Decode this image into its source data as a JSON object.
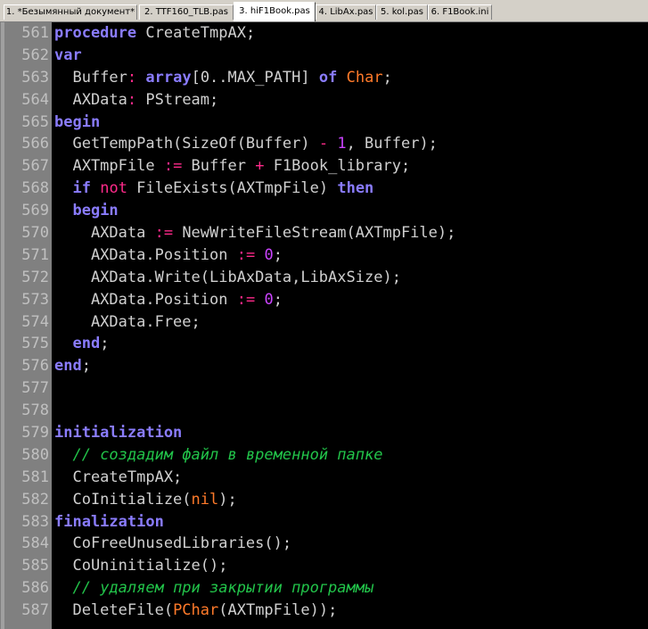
{
  "tabs": [
    {
      "label": "1. *Безымянный документ*",
      "active": false
    },
    {
      "label": "2. TTF160_TLB.pas",
      "active": false
    },
    {
      "label": "3. hiF1Book.pas",
      "active": true
    },
    {
      "label": "4. LibAx.pas",
      "active": false
    },
    {
      "label": "5. kol.pas",
      "active": false
    },
    {
      "label": "6. F1Book.ini",
      "active": false
    }
  ],
  "colors": {
    "background": "#000000",
    "gutter": "#808080",
    "keyword": "#8a7cff",
    "operator": "#ff2a8a",
    "number": "#cc44ff",
    "type": "#ff7a2a",
    "comment": "#22c44a",
    "identifier": "#d0d0d0"
  },
  "lines": [
    {
      "num": "561",
      "tokens": [
        {
          "t": "procedure",
          "c": "kw"
        },
        {
          "t": " CreateTmpAX;",
          "c": "id"
        }
      ]
    },
    {
      "num": "562",
      "tokens": [
        {
          "t": "var",
          "c": "kw"
        }
      ]
    },
    {
      "num": "563",
      "tokens": [
        {
          "t": "  Buffer",
          "c": "id"
        },
        {
          "t": ":",
          "c": "sym"
        },
        {
          "t": " ",
          "c": "id"
        },
        {
          "t": "array",
          "c": "kw"
        },
        {
          "t": "[0..MAX_PATH] ",
          "c": "id"
        },
        {
          "t": "of",
          "c": "kw"
        },
        {
          "t": " ",
          "c": "id"
        },
        {
          "t": "Char",
          "c": "typ"
        },
        {
          "t": ";",
          "c": "id"
        }
      ]
    },
    {
      "num": "564",
      "tokens": [
        {
          "t": "  AXData",
          "c": "id"
        },
        {
          "t": ":",
          "c": "sym"
        },
        {
          "t": " PStream;",
          "c": "id"
        }
      ]
    },
    {
      "num": "565",
      "tokens": [
        {
          "t": "begin",
          "c": "kw"
        }
      ]
    },
    {
      "num": "566",
      "tokens": [
        {
          "t": "  GetTempPath(SizeOf(Buffer) ",
          "c": "id"
        },
        {
          "t": "-",
          "c": "sym"
        },
        {
          "t": " ",
          "c": "id"
        },
        {
          "t": "1",
          "c": "num"
        },
        {
          "t": ", Buffer);",
          "c": "id"
        }
      ]
    },
    {
      "num": "567",
      "tokens": [
        {
          "t": "  AXTmpFile ",
          "c": "id"
        },
        {
          "t": ":=",
          "c": "sym"
        },
        {
          "t": " Buffer ",
          "c": "id"
        },
        {
          "t": "+",
          "c": "sym"
        },
        {
          "t": " F1Book_library;",
          "c": "id"
        }
      ]
    },
    {
      "num": "568",
      "tokens": [
        {
          "t": "  ",
          "c": "id"
        },
        {
          "t": "if",
          "c": "kw"
        },
        {
          "t": " ",
          "c": "id"
        },
        {
          "t": "not",
          "c": "sym"
        },
        {
          "t": " FileExists(AXTmpFile) ",
          "c": "id"
        },
        {
          "t": "then",
          "c": "kw"
        }
      ]
    },
    {
      "num": "569",
      "tokens": [
        {
          "t": "  ",
          "c": "id"
        },
        {
          "t": "begin",
          "c": "kw"
        }
      ]
    },
    {
      "num": "570",
      "tokens": [
        {
          "t": "    AXData ",
          "c": "id"
        },
        {
          "t": ":=",
          "c": "sym"
        },
        {
          "t": " NewWriteFileStream(AXTmpFile);",
          "c": "id"
        }
      ]
    },
    {
      "num": "571",
      "tokens": [
        {
          "t": "    AXData.Position ",
          "c": "id"
        },
        {
          "t": ":=",
          "c": "sym"
        },
        {
          "t": " ",
          "c": "id"
        },
        {
          "t": "0",
          "c": "num"
        },
        {
          "t": ";",
          "c": "id"
        }
      ]
    },
    {
      "num": "572",
      "tokens": [
        {
          "t": "    AXData.Write(LibAxData,LibAxSize);",
          "c": "id"
        }
      ]
    },
    {
      "num": "573",
      "tokens": [
        {
          "t": "    AXData.Position ",
          "c": "id"
        },
        {
          "t": ":=",
          "c": "sym"
        },
        {
          "t": " ",
          "c": "id"
        },
        {
          "t": "0",
          "c": "num"
        },
        {
          "t": ";",
          "c": "id"
        }
      ]
    },
    {
      "num": "574",
      "tokens": [
        {
          "t": "    AXData.Free;",
          "c": "id"
        }
      ]
    },
    {
      "num": "575",
      "tokens": [
        {
          "t": "  ",
          "c": "id"
        },
        {
          "t": "end",
          "c": "kw"
        },
        {
          "t": ";",
          "c": "id"
        }
      ]
    },
    {
      "num": "576",
      "tokens": [
        {
          "t": "end",
          "c": "kw"
        },
        {
          "t": ";",
          "c": "id"
        }
      ]
    },
    {
      "num": "577",
      "tokens": []
    },
    {
      "num": "578",
      "tokens": []
    },
    {
      "num": "579",
      "tokens": [
        {
          "t": "initialization",
          "c": "kw"
        }
      ]
    },
    {
      "num": "580",
      "tokens": [
        {
          "t": "  ",
          "c": "id"
        },
        {
          "t": "// создадим файл в временной папке",
          "c": "cmt"
        }
      ]
    },
    {
      "num": "581",
      "tokens": [
        {
          "t": "  CreateTmpAX;",
          "c": "id"
        }
      ]
    },
    {
      "num": "582",
      "tokens": [
        {
          "t": "  CoInitialize(",
          "c": "id"
        },
        {
          "t": "nil",
          "c": "typ"
        },
        {
          "t": ");",
          "c": "id"
        }
      ]
    },
    {
      "num": "583",
      "tokens": [
        {
          "t": "finalization",
          "c": "kw"
        }
      ]
    },
    {
      "num": "584",
      "tokens": [
        {
          "t": "  CoFreeUnusedLibraries();",
          "c": "id"
        }
      ]
    },
    {
      "num": "585",
      "tokens": [
        {
          "t": "  CoUninitialize();",
          "c": "id"
        }
      ]
    },
    {
      "num": "586",
      "tokens": [
        {
          "t": "  ",
          "c": "id"
        },
        {
          "t": "// удаляем при закрытии программы",
          "c": "cmt"
        }
      ]
    },
    {
      "num": "587",
      "tokens": [
        {
          "t": "  DeleteFile(",
          "c": "id"
        },
        {
          "t": "PChar",
          "c": "typ"
        },
        {
          "t": "(AXTmpFile));",
          "c": "id"
        }
      ]
    }
  ]
}
